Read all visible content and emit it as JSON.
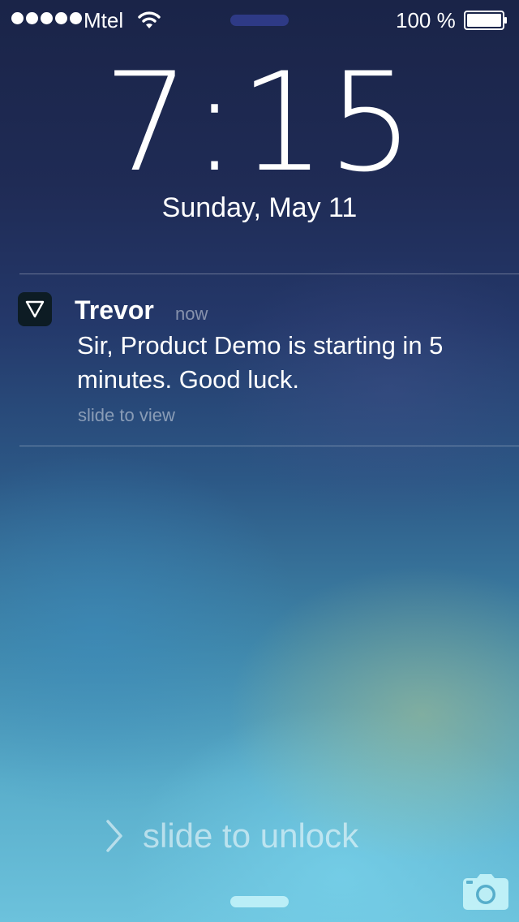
{
  "status_bar": {
    "carrier": "Mtel",
    "battery_percent": "100 %",
    "signal_bars": 5,
    "icons": [
      "signal-dots-icon",
      "wifi-icon",
      "battery-icon"
    ]
  },
  "lock": {
    "time": "7:15",
    "date": "Sunday, May 11"
  },
  "notification": {
    "app_icon": "triangle-down-icon",
    "sender": "Trevor",
    "time": "now",
    "message": "Sir, Product Demo is starting in 5 minutes. Good luck.",
    "action_hint": "slide to view"
  },
  "unlock": {
    "label": "slide to unlock",
    "icons": [
      "chevron-right-icon",
      "camera-icon"
    ]
  },
  "colors": {
    "text": "#ffffff",
    "top_background": "#1a2448",
    "bottom_background": "#6cc2dc",
    "app_icon_background": "#0d1c24"
  }
}
